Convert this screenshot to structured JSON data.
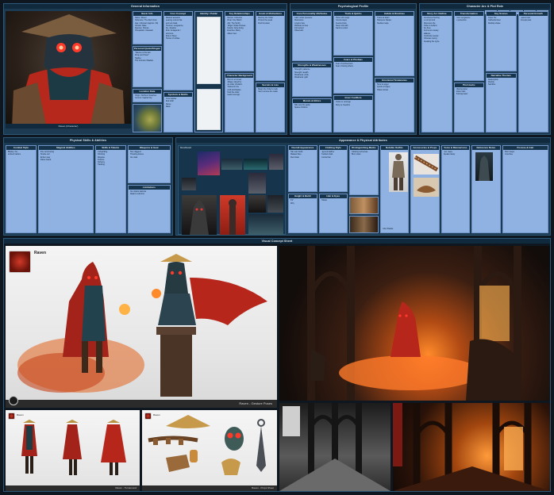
{
  "panels": {
    "general": {
      "title": "General Information",
      "portrait_caption": "Raven (Character)",
      "cards": {
        "basic": {
          "title": "Basic Info",
          "lines": [
            "Name: Raven",
            "Nickname: The Red Crow",
            "Age: Unknown (approx. 30)",
            "Gender: Male",
            "Species: Human",
            "Occupation: Assassin"
          ]
        },
        "notes": {
          "title": "Personal Quote/Slogan",
          "lines": [
            "\"Silence is the last",
            "thing you'll hear.\"",
            "",
            "Tagline:",
            "The Crimson Shadow"
          ]
        },
        "location": {
          "title": "Location Data",
          "lines": [
            "Origin: Northern Reaches",
            "Current: Capital City",
            "Affiliation: Guild"
          ]
        },
        "lore": {
          "title": "Core Concept",
          "lines": [
            "Masked assassin",
            "wearing conical hat",
            "and red cloak.",
            "",
            "Themes: vengeance,",
            "fire, shadow.",
            "",
            "Role: Antagonist /",
            "anti-hero.",
            "",
            "Role in Story:",
            "Hunter of nobles"
          ]
        },
        "voice": {
          "title": "Symbols & Motifs",
          "lines": [
            "Crow feather",
            "Red cloth",
            "Flame",
            "Mask"
          ]
        },
        "identity": {
          "title": "Identity / Public Persona",
          "lines": []
        },
        "relations": {
          "title": "Key Relationships",
          "lines": [
            "Mentor: Unknown",
            "Rival: City Watch",
            "Ally: The Smith",
            "Target: Noble Houses",
            "",
            "Family: None living",
            "",
            "Enemies: Many",
            "Allies: Few"
          ]
        },
        "history": {
          "title": "Character Background",
          "lines": [
            "Born in a burned",
            "village; raised by",
            "an order of killers.",
            "",
            "Trained in fire",
            "craft and blades.",
            "",
            "Fled the order;",
            "seeks revenge."
          ]
        },
        "goals": {
          "title": "Goals & Motivations",
          "lines": [
            "Destroy the Order",
            "Protect the weak",
            "Find his sister"
          ]
        },
        "secrets": {
          "title": "Secrets & Lies",
          "lines": [
            "Bears the Order's mark",
            "Can't remove the mask"
          ]
        }
      }
    },
    "psych": {
      "title": "Psychological Profile",
      "cards": {
        "personality": {
          "title": "Core Personality Attributes",
          "lines": [
            "Calm under pressure",
            "Meticulous",
            "Loyal to few",
            "Ruthless to foes",
            "",
            "Introverted",
            "Observant"
          ]
        },
        "traits": {
          "title": "Traits & Quirks",
          "lines": [
            "Hums old songs",
            "Counts steps",
            "Feeds crows",
            "Never sits with",
            "back to a door"
          ]
        },
        "strengths": {
          "title": "Strengths & Weaknesses",
          "lines": [
            "Strength: patience",
            "Strength: stealth",
            "Weakness: pride",
            "Weakness: guilt"
          ]
        },
        "fears": {
          "title": "Fears & Phobias",
          "lines": [
            "Fear of confinement",
            "Fear of losing others"
          ]
        },
        "values": {
          "title": "Inner Conflicts",
          "lines": [
            "Code vs. revenge",
            "Duty vs. freedom"
          ]
        },
        "morals": {
          "title": "Morals & Ethics",
          "lines": [
            "Kills only the guilty",
            "Spares children"
          ]
        },
        "habits": {
          "title": "Habits & Routines",
          "lines": [
            "Trains at dawn",
            "Sharpens blades",
            "Studies maps"
          ]
        },
        "emotional": {
          "title": "Emotional Tendencies",
          "lines": [
            "Slow to anger",
            "Quick to forgive",
            "Hides sorrow"
          ]
        }
      }
    },
    "arc": {
      "title": "Character Arc & Plot Role",
      "tabs": [
        "Intro",
        "Act I",
        "Act II",
        "Climax",
        "Resolution"
      ],
      "cards": {
        "story": {
          "title": "Story Arc Outline",
          "lines": [
            "Introduced hunting",
            "a corrupt lord.",
            "",
            "Discovers the",
            "Order is behind",
            "the fires.",
            "",
            "Forms an uneasy",
            "alliance.",
            "",
            "Confronts mentor.",
            "",
            "Chooses mercy,",
            "breaking the cycle."
          ]
        },
        "internal": {
          "title": "Transformation",
          "lines": [
            "From vengeance",
            "to protection."
          ]
        },
        "external": {
          "title": "Plot Hooks",
          "lines": [
            "Missing sister",
            "Stolen relic",
            "Burning tower"
          ]
        },
        "key": {
          "title": "Key Scenes",
          "lines": [
            "Tower fire",
            "Cathedral duel",
            "Rooftop chase"
          ]
        },
        "theme": {
          "title": "Narrative Themes",
          "lines": [
            "Redemption",
            "Identity",
            "Sacrifice"
          ]
        },
        "themes2": {
          "title": "Personal Growth",
          "lines": [
            "Learns trust",
            "Accepts past"
          ]
        }
      }
    },
    "physical": {
      "title": "Physical Skills & Abilities",
      "cards": {
        "combat": {
          "title": "Combat Style",
          "lines": [
            "Blades, fire,",
            "ambush tactics"
          ]
        },
        "magic": {
          "title": "Magical Abilities",
          "lines": [
            "Fire summoning",
            "Smoke veil",
            "Ember step",
            "Flame brand"
          ]
        },
        "skills": {
          "title": "Skills & Talents",
          "lines": [
            "Lockpicking",
            "Climbing",
            "Disguise",
            "Poisons",
            "Alchemy",
            "Tracking"
          ]
        },
        "weapons": {
          "title": "Weapons & Gear",
          "lines": [
            "Twin daggers",
            "Throwing knives",
            "Fire vials"
          ]
        },
        "limits": {
          "title": "Limitations",
          "lines": [
            "Fire drains stamina",
            "Weak to cold iron"
          ]
        }
      }
    },
    "appearance": {
      "title": "Appearance & Physical Attributes",
      "mood_title": "Moodboard",
      "cards": {
        "overall": {
          "title": "Overall Appearance",
          "lines": [
            "Tall, lean build",
            "Masked face",
            "Red cloak"
          ]
        },
        "height": {
          "title": "Height & Build",
          "lines": [
            "6'1\"",
            "Wiry"
          ]
        },
        "clothing": {
          "title": "Clothing Style",
          "lines": [
            "Layered leather",
            "Hooded cloak",
            "Conical hat"
          ]
        },
        "distinct": {
          "title": "Distinguishing Marks",
          "lines": [
            "Glowing red lenses",
            "Burn scars"
          ]
        },
        "hair": {
          "title": "Hair & Eyes",
          "lines": [
            "Hidden"
          ]
        },
        "colors": {
          "title": "Color Palette",
          "lines": [
            "Red",
            "Teal",
            "Bronze"
          ]
        },
        "props_t": {
          "title": "Notable Outfits",
          "lines": []
        },
        "access": {
          "title": "Accessories & Props",
          "lines": []
        },
        "voice2": {
          "title": "Voice & Mannerisms",
          "lines": [
            "Low, raspy",
            "Speaks rarely"
          ]
        },
        "ref": {
          "title": "Reference Notes",
          "lines": []
        },
        "body": {
          "title": "Posture & Gait",
          "lines": [
            "Silent steps",
            "Crouches"
          ]
        }
      }
    },
    "visual": {
      "title": "Visual Concept Sheet"
    }
  },
  "art": {
    "gesture_name": "Raven",
    "gesture_caption": "Raven - Gesture Poses",
    "turnaround_name": "Raven",
    "turnaround_caption": "Raven - Turnaround",
    "props_name": "Raven",
    "props_caption": "Raven - Props Sheet"
  }
}
